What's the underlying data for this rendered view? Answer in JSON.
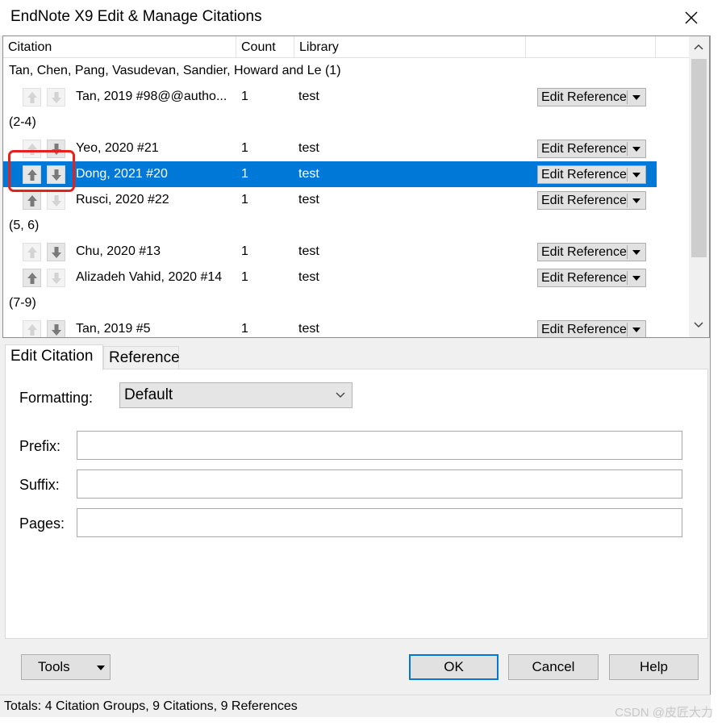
{
  "window": {
    "title": "EndNote X9 Edit & Manage Citations"
  },
  "columns": {
    "citation": "Citation",
    "count": "Count",
    "library": "Library"
  },
  "groups": [
    {
      "label": "Tan, Chen, Pang, Vasudevan, Sandier, Howard and Le (1)"
    },
    {
      "label": "(2-4)"
    },
    {
      "label": "(5, 6)"
    },
    {
      "label": "(7-9)"
    }
  ],
  "rows": [
    {
      "citation": "Tan, 2019 #98@@autho...",
      "count": "1",
      "library": "test",
      "action": "Edit Reference",
      "up_enabled": false,
      "down_enabled": false,
      "selected": false
    },
    {
      "citation": "Yeo, 2020 #21",
      "count": "1",
      "library": "test",
      "action": "Edit Reference",
      "up_enabled": false,
      "down_enabled": true,
      "selected": false
    },
    {
      "citation": "Dong, 2021 #20",
      "count": "1",
      "library": "test",
      "action": "Edit Reference",
      "up_enabled": true,
      "down_enabled": true,
      "selected": true
    },
    {
      "citation": "Rusci, 2020 #22",
      "count": "1",
      "library": "test",
      "action": "Edit Reference",
      "up_enabled": true,
      "down_enabled": false,
      "selected": false
    },
    {
      "citation": "Chu, 2020 #13",
      "count": "1",
      "library": "test",
      "action": "Edit Reference",
      "up_enabled": false,
      "down_enabled": true,
      "selected": false
    },
    {
      "citation": "Alizadeh Vahid, 2020 #14",
      "count": "1",
      "library": "test",
      "action": "Edit Reference",
      "up_enabled": true,
      "down_enabled": false,
      "selected": false
    },
    {
      "citation": "Tan, 2019 #5",
      "count": "1",
      "library": "test",
      "action": "Edit Reference",
      "up_enabled": false,
      "down_enabled": true,
      "selected": false
    }
  ],
  "tabs": {
    "edit_citation": "Edit Citation",
    "reference": "Reference"
  },
  "form": {
    "formatting_label": "Formatting:",
    "formatting_value": "Default",
    "prefix_label": "Prefix:",
    "prefix_value": "",
    "suffix_label": "Suffix:",
    "suffix_value": "",
    "pages_label": "Pages:",
    "pages_value": ""
  },
  "buttons": {
    "tools": "Tools",
    "ok": "OK",
    "cancel": "Cancel",
    "help": "Help"
  },
  "status": {
    "totals": "Totals: 4 Citation Groups, 9 Citations, 9 References"
  },
  "watermark": "CSDN @皮匠大力",
  "colors": {
    "selection": "#0078d7",
    "highlight": "#e5211d"
  }
}
